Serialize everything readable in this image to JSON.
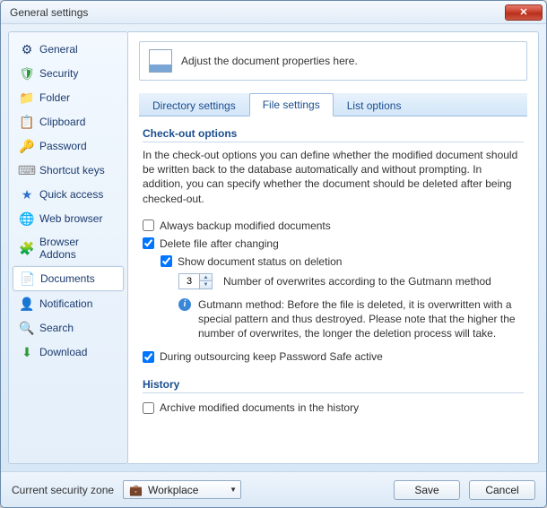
{
  "window": {
    "title": "General settings"
  },
  "sidebar": {
    "items": [
      {
        "label": "General",
        "icon": "⚙"
      },
      {
        "label": "Security",
        "icon": "🛡"
      },
      {
        "label": "Folder",
        "icon": "📁"
      },
      {
        "label": "Clipboard",
        "icon": "📋"
      },
      {
        "label": "Password",
        "icon": "🔑"
      },
      {
        "label": "Shortcut keys",
        "icon": "⌨"
      },
      {
        "label": "Quick access",
        "icon": "★"
      },
      {
        "label": "Web browser",
        "icon": "🌐"
      },
      {
        "label": "Browser Addons",
        "icon": "🧩"
      },
      {
        "label": "Documents",
        "icon": "📄"
      },
      {
        "label": "Notification",
        "icon": "👤"
      },
      {
        "label": "Search",
        "icon": "🔍"
      },
      {
        "label": "Download",
        "icon": "⬇"
      }
    ],
    "active_index": 9
  },
  "info": {
    "text": "Adjust the document properties here."
  },
  "tabs": {
    "items": [
      "Directory settings",
      "File settings",
      "List options"
    ],
    "active_index": 1
  },
  "checkout": {
    "title": "Check-out options",
    "desc": "In the check-out options you can define whether the modified document should be written back to the database automatically and without prompting. In addition, you can specify whether the document should be deleted after being checked-out.",
    "always_backup": {
      "label": "Always backup modified documents",
      "checked": false
    },
    "delete_after": {
      "label": "Delete file after changing",
      "checked": true
    },
    "show_status": {
      "label": "Show document status on deletion",
      "checked": true
    },
    "overwrites": {
      "value": "3",
      "label": "Number of overwrites according to the Gutmann method"
    },
    "gutmann_info": "Gutmann method: Before the file is deleted, it is overwritten with a special pattern and thus destroyed. Please note that the higher the number of overwrites, the longer the deletion process will take.",
    "keep_active": {
      "label": "During outsourcing keep Password Safe active",
      "checked": true
    }
  },
  "history": {
    "title": "History",
    "archive": {
      "label": "Archive modified documents in the history",
      "checked": false
    }
  },
  "footer": {
    "zone_label": "Current security zone",
    "zone_value": "Workplace",
    "save": "Save",
    "cancel": "Cancel"
  }
}
